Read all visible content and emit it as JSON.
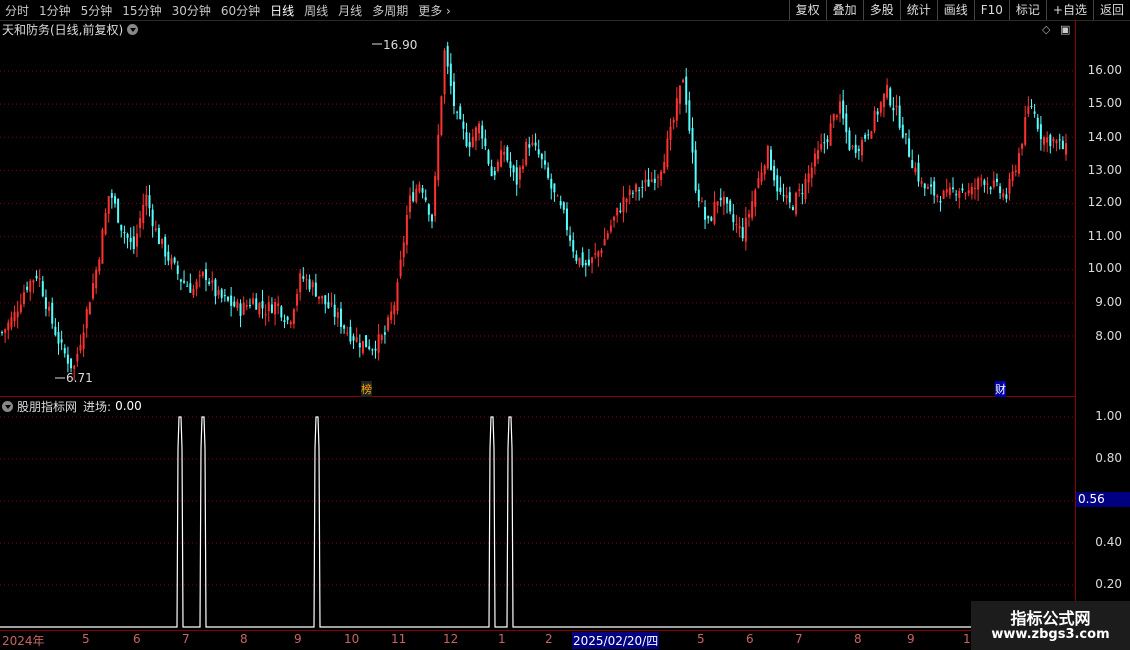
{
  "toolbar": {
    "timeframes": [
      "分时",
      "1分钟",
      "5分钟",
      "15分钟",
      "30分钟",
      "60分钟",
      "日线",
      "周线",
      "月线",
      "多周期",
      "更多"
    ],
    "active_index": 6,
    "right_buttons": [
      "复权",
      "叠加",
      "多股",
      "统计",
      "画线",
      "F10",
      "标记",
      "+自选",
      "返回"
    ]
  },
  "main_chart": {
    "title": "天和防务(日线,前复权)",
    "y_ticks": [
      "16.00",
      "15.00",
      "14.00",
      "13.00",
      "12.00",
      "11.00",
      "10.00",
      "9.00",
      "8.00"
    ],
    "high_label": "16.90",
    "low_label": "6.71",
    "badges": [
      "榜",
      "财"
    ],
    "up_color": "#ff3232",
    "down_color": "#54ffff"
  },
  "indicator": {
    "name": "股朋指标网",
    "series_label": "进场:",
    "series_value": "0.00",
    "y_ticks": [
      "1.00",
      "0.80",
      "0.40",
      "0.20"
    ],
    "cursor_value": "0.56"
  },
  "x_axis": {
    "labels": [
      "2024年",
      "5",
      "6",
      "7",
      "8",
      "9",
      "10",
      "11",
      "12",
      "1",
      "2",
      "2025/02/20/四",
      "5",
      "6",
      "7",
      "8",
      "9",
      "1"
    ]
  },
  "watermark": {
    "line1": "指标公式网",
    "line2": "www.zbgs3.com"
  },
  "chart_data": {
    "type": "candlestick",
    "title": "天和防务(日线,前复权)",
    "ylim": [
      7.0,
      17.0
    ],
    "y_ticks": [
      8,
      9,
      10,
      11,
      12,
      13,
      14,
      15,
      16
    ],
    "annotations": [
      {
        "label": "16.90",
        "kind": "high"
      },
      {
        "label": "6.71",
        "kind": "low"
      }
    ],
    "x_labels": [
      "2024年",
      "5",
      "6",
      "7",
      "8",
      "9",
      "10",
      "11",
      "12",
      "1",
      "2",
      "2025/02/20/四",
      "5",
      "6",
      "7",
      "8",
      "9",
      "1"
    ],
    "close_path": [
      8.1,
      8.6,
      9.5,
      9.9,
      8.6,
      7.6,
      7.0,
      8.6,
      10.2,
      12.4,
      11.3,
      10.6,
      12.3,
      11.0,
      10.3,
      9.7,
      9.4,
      9.9,
      9.2,
      9.0,
      8.8,
      9.1,
      8.8,
      9.0,
      8.4,
      9.8,
      9.5,
      9.0,
      8.6,
      8.1,
      7.8,
      7.7,
      8.0,
      9.2,
      12.0,
      12.7,
      11.5,
      16.6,
      14.6,
      13.8,
      14.4,
      12.8,
      13.6,
      12.6,
      13.9,
      13.4,
      12.4,
      11.6,
      10.4,
      10.1,
      10.6,
      11.4,
      12.1,
      12.4,
      12.6,
      13.0,
      14.2,
      15.9,
      12.6,
      11.3,
      12.3,
      11.5,
      11.1,
      12.4,
      13.6,
      12.3,
      11.9,
      12.5,
      13.3,
      14.0,
      15.0,
      13.6,
      13.9,
      14.6,
      15.4,
      14.6,
      13.4,
      12.5,
      12.3,
      12.2,
      12.5,
      12.3,
      12.8,
      12.5,
      12.2,
      13.4,
      15.1,
      14.0,
      13.9,
      13.6
    ],
    "indicator": {
      "name": "进场",
      "value": 0.0,
      "ylim": [
        0,
        1.0
      ],
      "y_ticks": [
        0.2,
        0.4,
        0.8,
        1.0
      ],
      "signals": [
        {
          "bar_index": 29,
          "value": 1.0
        },
        {
          "bar_index": 33,
          "value": 1.0
        },
        {
          "bar_index": 52,
          "value": 1.0
        },
        {
          "bar_index": 83,
          "value": 1.0
        },
        {
          "bar_index": 86,
          "value": 1.0
        }
      ]
    }
  }
}
